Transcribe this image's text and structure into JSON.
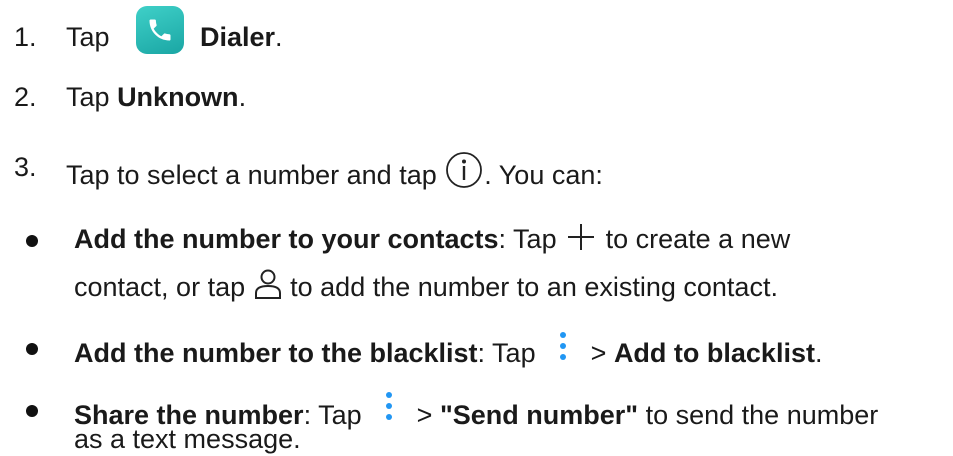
{
  "steps": [
    {
      "num": "1.",
      "pre": "Tap",
      "bold": "Dialer",
      "post": "."
    },
    {
      "num": "2.",
      "pre": "Tap",
      "bold": "Unknown",
      "post": "."
    },
    {
      "num": "3.",
      "pre": "Tap to select a number and tap",
      "post": ". You can:"
    }
  ],
  "bullets": [
    {
      "bold": "Add the number to your contacts",
      "pre": ": Tap",
      "mid": "to create a new",
      "line2_pre": "contact, or tap",
      "line2_post": "to add the number to an existing contact."
    },
    {
      "bold": "Add the number to the blacklist",
      "pre": ": Tap",
      "mid": ">",
      "bold2": "Add to blacklist",
      "post": "."
    },
    {
      "bold": "Share the number",
      "pre": ": Tap",
      "mid": ">",
      "bold2": "\"Send number\"",
      "post": "to send the number",
      "line2": "as a text message."
    }
  ],
  "icons": {
    "dialer": "phone-app-icon",
    "info": "info-circle-icon",
    "plus": "plus-icon",
    "person": "person-icon",
    "more": "vertical-dots-icon"
  },
  "colors": {
    "dialer": "#22b3ad",
    "dots": "#2196f3"
  }
}
